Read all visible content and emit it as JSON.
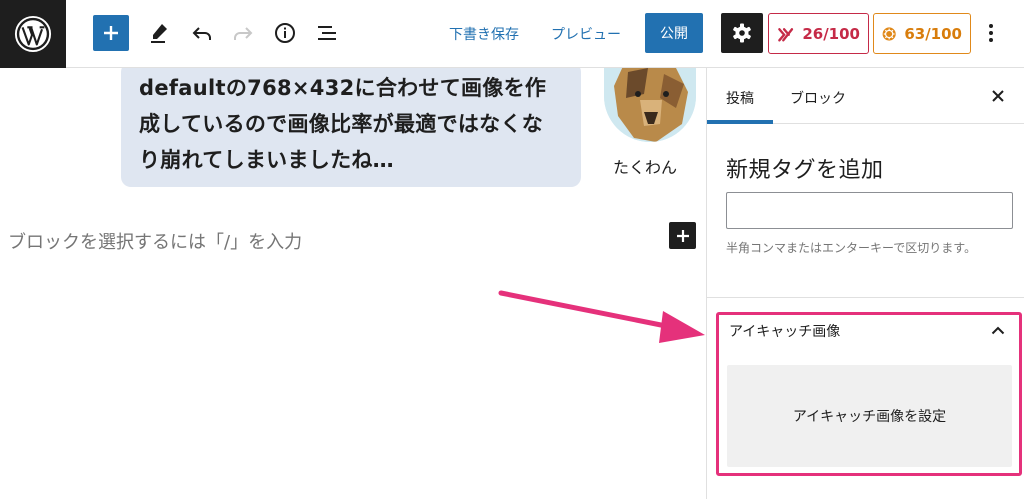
{
  "toolbar": {
    "save_draft": "下書き保存",
    "preview": "プレビュー",
    "publish": "公開",
    "score_seo": "26/100",
    "score_readability": "63/100"
  },
  "editor": {
    "bubble_text": "defaultの768×432に合わせて画像を作成しているので画像比率が最適ではなくなり崩れてしまいましたね…",
    "avatar_name": "たくわん",
    "block_placeholder": "ブロックを選択するには「/」を入力"
  },
  "sidebar": {
    "tabs": [
      {
        "label": "投稿",
        "active": true
      },
      {
        "label": "ブロック",
        "active": false
      }
    ],
    "tags": {
      "heading": "新規タグを追加",
      "input_value": "",
      "help": "半角コンマまたはエンターキーで区切ります。"
    },
    "featured_image": {
      "title": "アイキャッチ画像",
      "set_button": "アイキャッチ画像を設定"
    }
  },
  "colors": {
    "accent": "#2271b1",
    "highlight": "#e5317b",
    "seo_score": "#c52a47",
    "readability_score": "#e0891a"
  },
  "icons": [
    "wordpress-logo-icon",
    "plus-icon",
    "pen-icon",
    "undo-icon",
    "redo-icon",
    "info-icon",
    "list-view-icon",
    "gear-icon",
    "yoast-icon",
    "readability-icon",
    "more-vertical-icon",
    "close-icon",
    "chevron-up-icon"
  ]
}
